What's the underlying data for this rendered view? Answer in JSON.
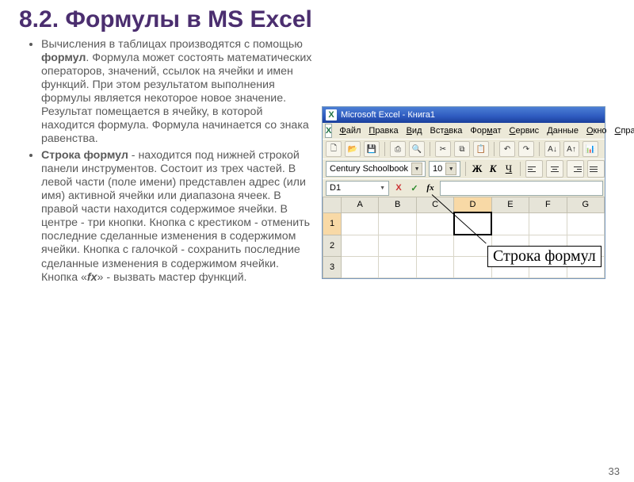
{
  "title": "8.2. Формулы в MS Excel",
  "bullets": {
    "p1a": "Вычисления в таблицах производятся с помощью ",
    "p1b": "формул",
    "p1c": ". Формула может состоять математических операторов, значений, ссылок на ячейки и имен функций. При этом результатом выполнения формулы является некоторое новое значение. Результат помещается в ячейку, в которой находится формула. Формула начинается со знака равенства.",
    "p2a": "Строка формул",
    "p2b": " - находится под нижней строкой панели инструментов. Состоит из трех частей. В левой части (поле имени) представлен адрес (или имя) активной ячейки или диапазона ячеек. В правой части находится содержимое ячейки. В центре - три кнопки. Кнопка с крестиком - отменить последние сделанные изменения в содержимом ячейки. Кнопка с галочкой - сохранить последние сделанные изменения в содержимом ячейки. Кнопка «",
    "p2c": "fx",
    "p2d": "» - вызвать мастер функций."
  },
  "excel": {
    "window_title": "Microsoft Excel - Книга1",
    "menu": [
      "Файл",
      "Правка",
      "Вид",
      "Вставка",
      "Формат",
      "Сервис",
      "Данные",
      "Окно",
      "Спра"
    ],
    "font_name": "Century Schoolbook",
    "font_size": "10",
    "style_labels": {
      "bold": "Ж",
      "italic": "К",
      "underline": "Ч"
    },
    "namebox": "D1",
    "cancel_label": "X",
    "ok_label": "✓",
    "fx_label": "fx",
    "columns": [
      "A",
      "B",
      "C",
      "D",
      "E",
      "F",
      "G"
    ],
    "rows": [
      "1",
      "2",
      "3"
    ],
    "callout": "Строка формул"
  },
  "page_number": "33"
}
